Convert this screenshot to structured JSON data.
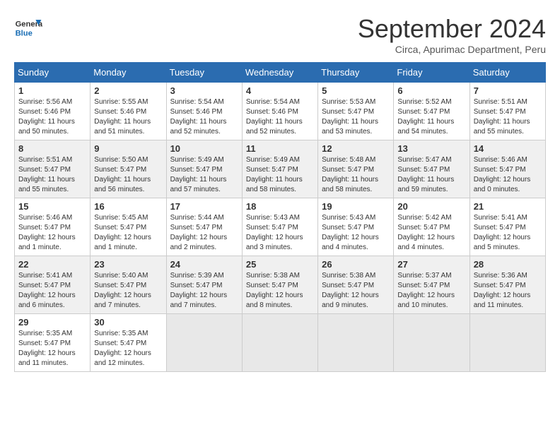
{
  "header": {
    "logo_line1": "General",
    "logo_line2": "Blue",
    "month_year": "September 2024",
    "location": "Circa, Apurimac Department, Peru"
  },
  "calendar": {
    "weekdays": [
      "Sunday",
      "Monday",
      "Tuesday",
      "Wednesday",
      "Thursday",
      "Friday",
      "Saturday"
    ],
    "weeks": [
      [
        {
          "day": "1",
          "info": "Sunrise: 5:56 AM\nSunset: 5:46 PM\nDaylight: 11 hours\nand 50 minutes."
        },
        {
          "day": "2",
          "info": "Sunrise: 5:55 AM\nSunset: 5:46 PM\nDaylight: 11 hours\nand 51 minutes."
        },
        {
          "day": "3",
          "info": "Sunrise: 5:54 AM\nSunset: 5:46 PM\nDaylight: 11 hours\nand 52 minutes."
        },
        {
          "day": "4",
          "info": "Sunrise: 5:54 AM\nSunset: 5:46 PM\nDaylight: 11 hours\nand 52 minutes."
        },
        {
          "day": "5",
          "info": "Sunrise: 5:53 AM\nSunset: 5:47 PM\nDaylight: 11 hours\nand 53 minutes."
        },
        {
          "day": "6",
          "info": "Sunrise: 5:52 AM\nSunset: 5:47 PM\nDaylight: 11 hours\nand 54 minutes."
        },
        {
          "day": "7",
          "info": "Sunrise: 5:51 AM\nSunset: 5:47 PM\nDaylight: 11 hours\nand 55 minutes."
        }
      ],
      [
        {
          "day": "8",
          "info": "Sunrise: 5:51 AM\nSunset: 5:47 PM\nDaylight: 11 hours\nand 55 minutes."
        },
        {
          "day": "9",
          "info": "Sunrise: 5:50 AM\nSunset: 5:47 PM\nDaylight: 11 hours\nand 56 minutes."
        },
        {
          "day": "10",
          "info": "Sunrise: 5:49 AM\nSunset: 5:47 PM\nDaylight: 11 hours\nand 57 minutes."
        },
        {
          "day": "11",
          "info": "Sunrise: 5:49 AM\nSunset: 5:47 PM\nDaylight: 11 hours\nand 58 minutes."
        },
        {
          "day": "12",
          "info": "Sunrise: 5:48 AM\nSunset: 5:47 PM\nDaylight: 11 hours\nand 58 minutes."
        },
        {
          "day": "13",
          "info": "Sunrise: 5:47 AM\nSunset: 5:47 PM\nDaylight: 11 hours\nand 59 minutes."
        },
        {
          "day": "14",
          "info": "Sunrise: 5:46 AM\nSunset: 5:47 PM\nDaylight: 12 hours\nand 0 minutes."
        }
      ],
      [
        {
          "day": "15",
          "info": "Sunrise: 5:46 AM\nSunset: 5:47 PM\nDaylight: 12 hours\nand 1 minute."
        },
        {
          "day": "16",
          "info": "Sunrise: 5:45 AM\nSunset: 5:47 PM\nDaylight: 12 hours\nand 1 minute."
        },
        {
          "day": "17",
          "info": "Sunrise: 5:44 AM\nSunset: 5:47 PM\nDaylight: 12 hours\nand 2 minutes."
        },
        {
          "day": "18",
          "info": "Sunrise: 5:43 AM\nSunset: 5:47 PM\nDaylight: 12 hours\nand 3 minutes."
        },
        {
          "day": "19",
          "info": "Sunrise: 5:43 AM\nSunset: 5:47 PM\nDaylight: 12 hours\nand 4 minutes."
        },
        {
          "day": "20",
          "info": "Sunrise: 5:42 AM\nSunset: 5:47 PM\nDaylight: 12 hours\nand 4 minutes."
        },
        {
          "day": "21",
          "info": "Sunrise: 5:41 AM\nSunset: 5:47 PM\nDaylight: 12 hours\nand 5 minutes."
        }
      ],
      [
        {
          "day": "22",
          "info": "Sunrise: 5:41 AM\nSunset: 5:47 PM\nDaylight: 12 hours\nand 6 minutes."
        },
        {
          "day": "23",
          "info": "Sunrise: 5:40 AM\nSunset: 5:47 PM\nDaylight: 12 hours\nand 7 minutes."
        },
        {
          "day": "24",
          "info": "Sunrise: 5:39 AM\nSunset: 5:47 PM\nDaylight: 12 hours\nand 7 minutes."
        },
        {
          "day": "25",
          "info": "Sunrise: 5:38 AM\nSunset: 5:47 PM\nDaylight: 12 hours\nand 8 minutes."
        },
        {
          "day": "26",
          "info": "Sunrise: 5:38 AM\nSunset: 5:47 PM\nDaylight: 12 hours\nand 9 minutes."
        },
        {
          "day": "27",
          "info": "Sunrise: 5:37 AM\nSunset: 5:47 PM\nDaylight: 12 hours\nand 10 minutes."
        },
        {
          "day": "28",
          "info": "Sunrise: 5:36 AM\nSunset: 5:47 PM\nDaylight: 12 hours\nand 11 minutes."
        }
      ],
      [
        {
          "day": "29",
          "info": "Sunrise: 5:35 AM\nSunset: 5:47 PM\nDaylight: 12 hours\nand 11 minutes."
        },
        {
          "day": "30",
          "info": "Sunrise: 5:35 AM\nSunset: 5:47 PM\nDaylight: 12 hours\nand 12 minutes."
        },
        {
          "day": "",
          "info": ""
        },
        {
          "day": "",
          "info": ""
        },
        {
          "day": "",
          "info": ""
        },
        {
          "day": "",
          "info": ""
        },
        {
          "day": "",
          "info": ""
        }
      ]
    ]
  }
}
